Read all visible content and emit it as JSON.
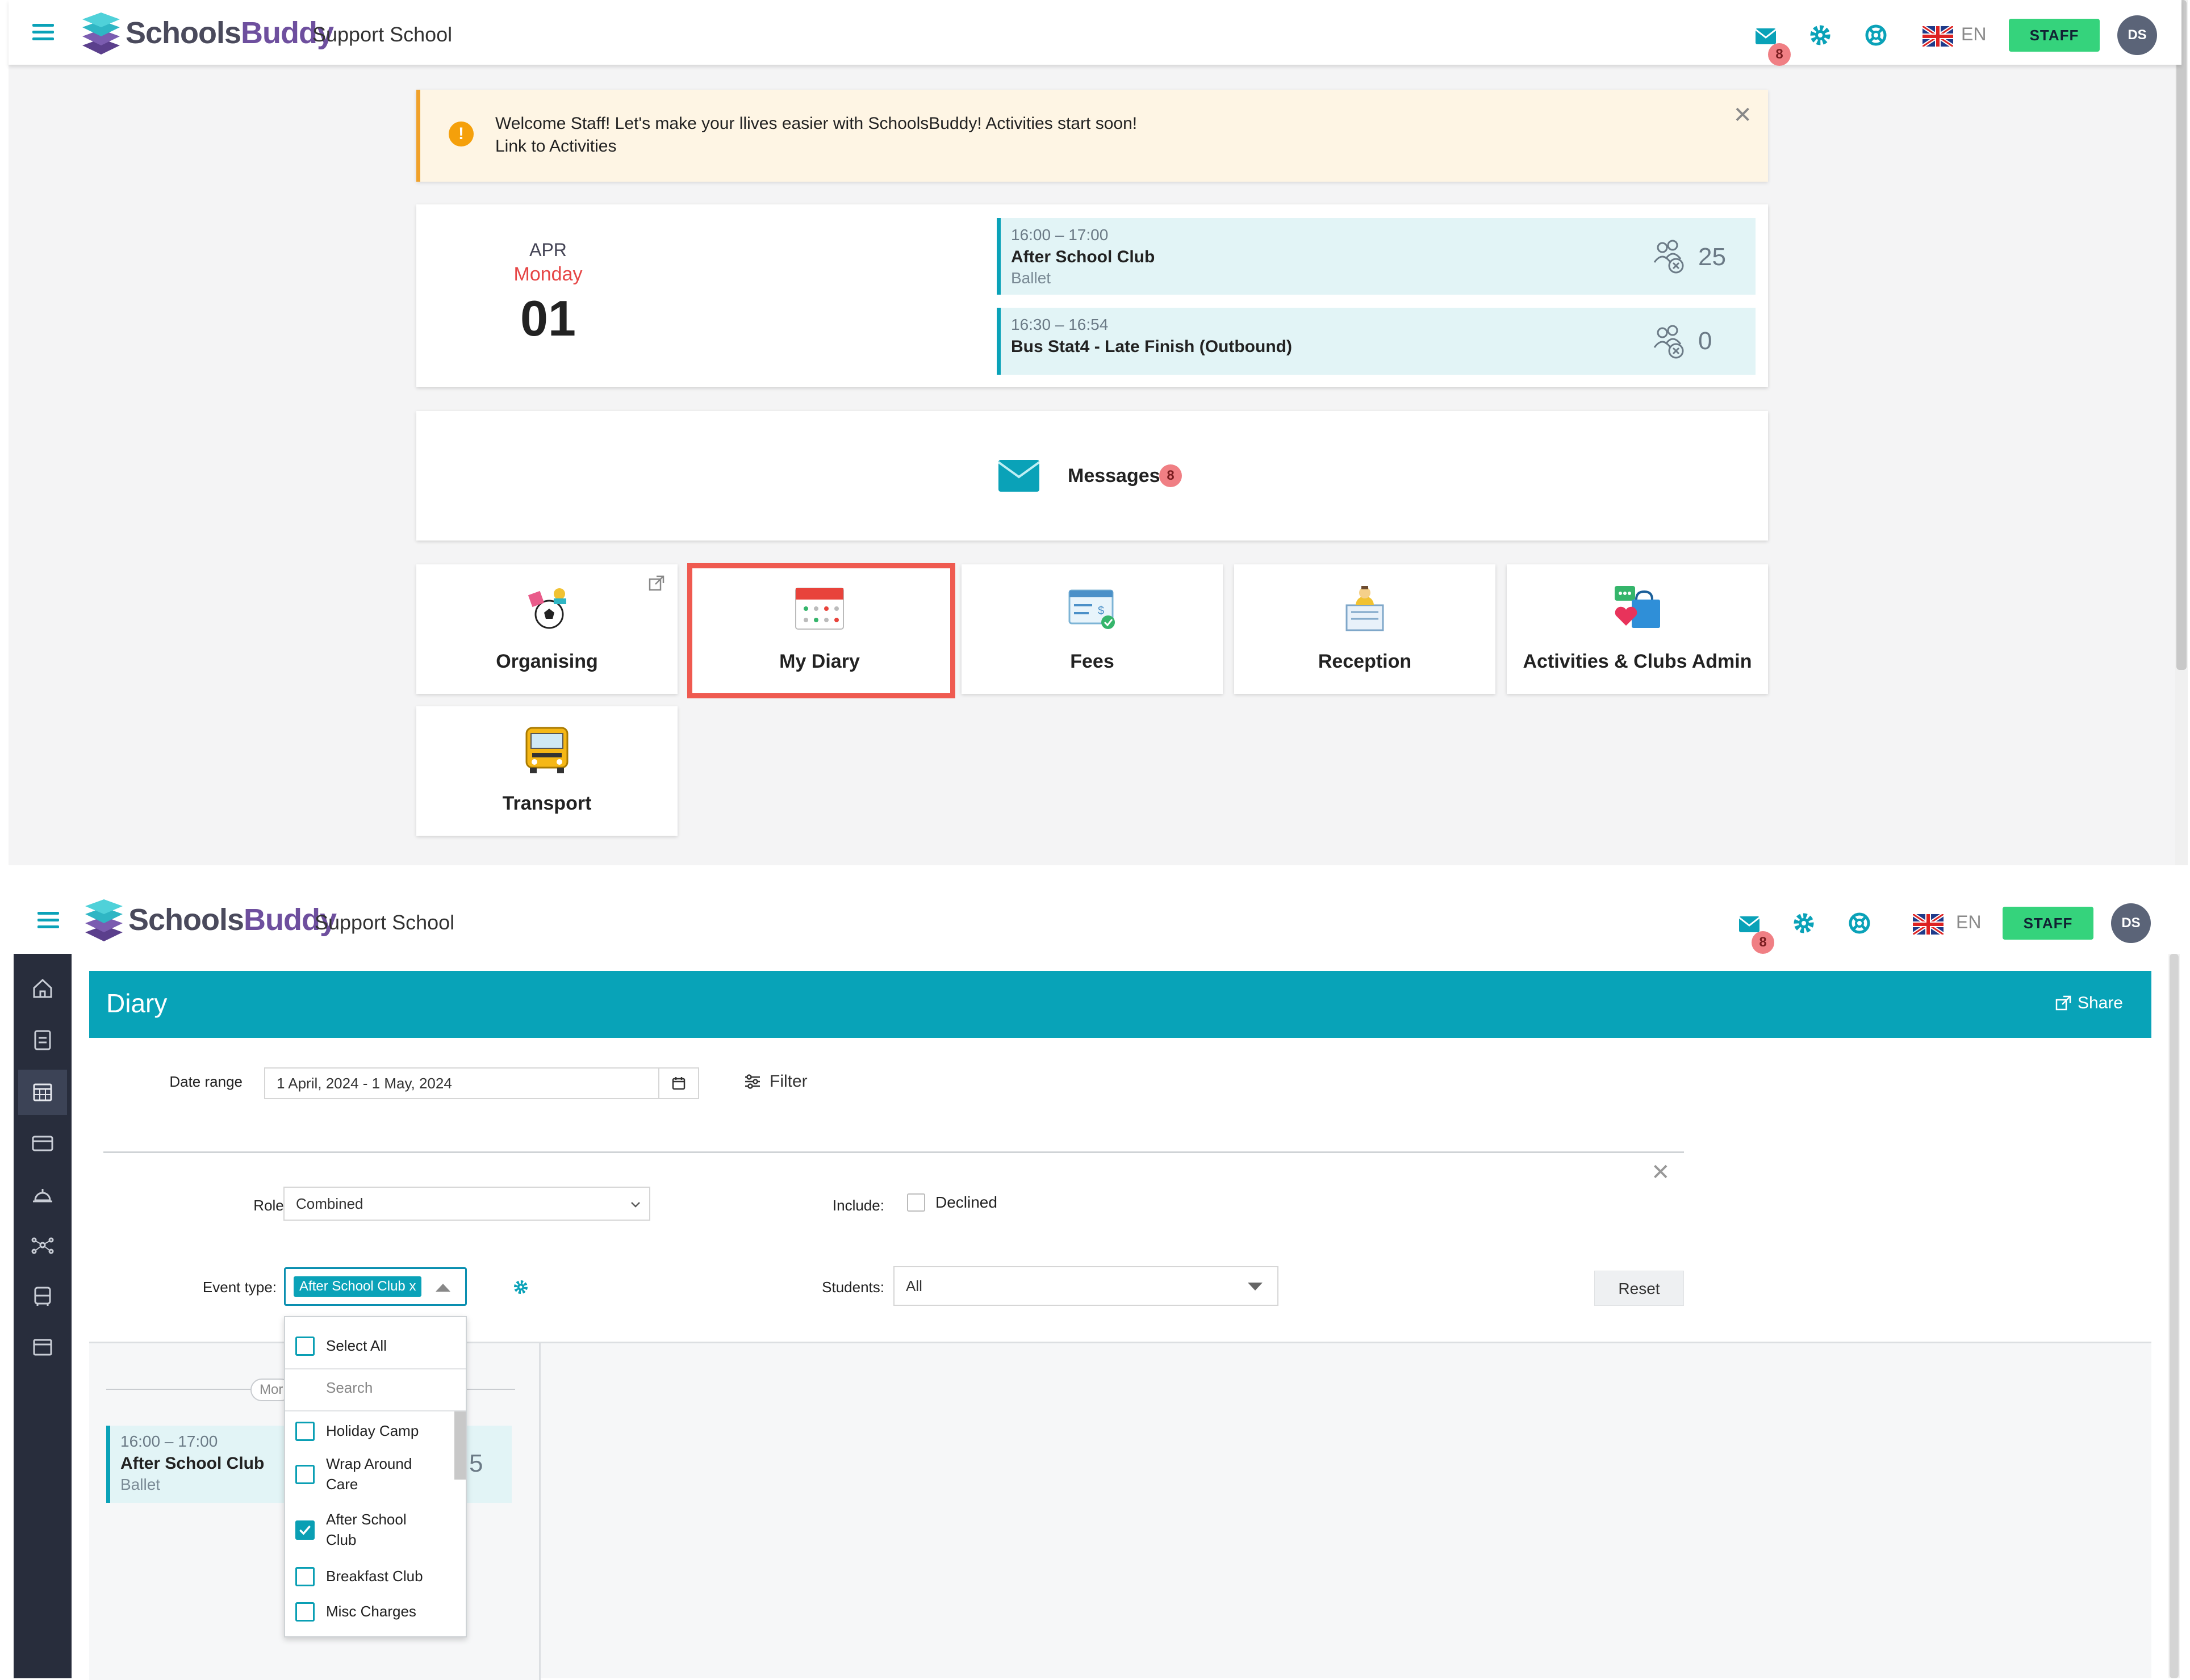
{
  "header": {
    "brand_prefix": "Schools",
    "brand_suffix": "Buddy",
    "school": "Support School",
    "message_count": "8",
    "language": "EN",
    "role_button": "STAFF",
    "avatar_initials": "DS"
  },
  "home": {
    "alert_line1": "Welcome Staff!  Let's make your llives easier with SchoolsBuddy!  Activities start soon!",
    "alert_link_prefix": "Link to ",
    "alert_link": "Activities",
    "date": {
      "month": "APR",
      "weekday": "Monday",
      "day": "01"
    },
    "events": [
      {
        "time": "16:00 – 17:00",
        "title": "After School Club",
        "subtitle": "Ballet",
        "count": "25"
      },
      {
        "time": "16:30 – 16:54",
        "title": "Bus Stat4 - Late Finish (Outbound)",
        "subtitle": "",
        "count": "0"
      }
    ],
    "messages_label": "Messages",
    "messages_count": "8",
    "tiles": [
      "Organising",
      "My Diary",
      "Fees",
      "Reception",
      "Activities & Clubs Admin",
      "Transport"
    ],
    "tile_icons": [
      "sports-ball-icon",
      "calendar-icon",
      "invoice-icon",
      "reception-bell-icon",
      "clubs-admin-icon",
      "school-bus-icon"
    ],
    "highlight_tile": "My Diary"
  },
  "diary": {
    "title": "Diary",
    "share_label": "Share",
    "date_range_label": "Date range",
    "date_range_value": "1 April, 2024 - 1 May, 2024",
    "filter_label": "Filter",
    "role_label": "Role:",
    "role_value": "Combined",
    "include_label": "Include:",
    "declined_label": "Declined",
    "event_type_label": "Event type:",
    "event_type_tag": "After School Club",
    "event_type_tag_remove": "x",
    "students_label": "Students:",
    "students_value": "All",
    "reset_label": "Reset",
    "day_chip": "Mor",
    "event": {
      "time": "16:00 – 17:00",
      "title": "After School Club",
      "subtitle": "Ballet",
      "count_partial": "5"
    },
    "dropdown": {
      "select_all": "Select All",
      "search_placeholder": "Search",
      "options": [
        {
          "label": "Holiday Camp",
          "checked": false
        },
        {
          "label": "Wrap Around Care",
          "checked": false
        },
        {
          "label": "After School Club",
          "checked": true
        },
        {
          "label": "Breakfast Club",
          "checked": false
        },
        {
          "label": "Misc Charges",
          "checked": false
        }
      ]
    }
  },
  "colors": {
    "accent": "#0aa2b8",
    "brand_purple": "#6e4f9e",
    "staff_green": "#35d37c",
    "highlight_red": "#ef5a50",
    "badge_red": "#f07f84",
    "sidebar": "#282d3c"
  }
}
